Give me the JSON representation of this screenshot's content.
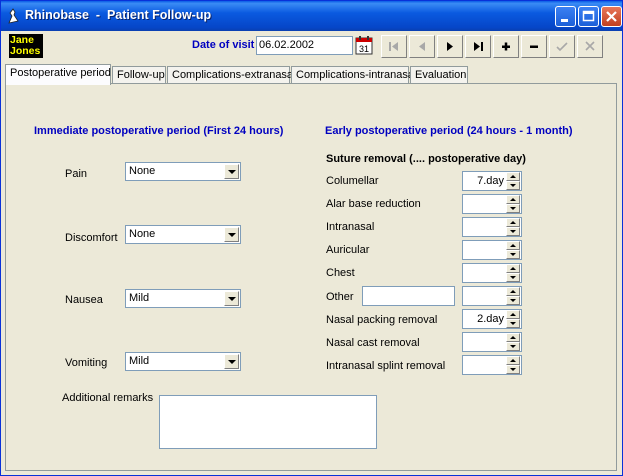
{
  "window": {
    "title": "Rhinobase  -  Patient Follow-up"
  },
  "patient": {
    "name_line1": "Jane",
    "name_line2": "Jones"
  },
  "visit": {
    "label": "Date of visit",
    "date": "06.02.2002"
  },
  "nav": [
    "first-icon",
    "prev-icon",
    "next-icon",
    "last-icon",
    "add-icon",
    "delete-icon",
    "save-icon",
    "cancel-icon"
  ],
  "tabs": [
    {
      "label": "Postoperative period",
      "active": true
    },
    {
      "label": "Follow-up"
    },
    {
      "label": "Complications-extranasal"
    },
    {
      "label": "Complications-intranasal"
    },
    {
      "label": "Evaluation"
    }
  ],
  "immediate": {
    "title": "Immediate postoperative period (First 24 hours)",
    "fields": [
      {
        "label": "Pain",
        "value": "None"
      },
      {
        "label": "Discomfort",
        "value": "None"
      },
      {
        "label": "Nausea",
        "value": "Mild"
      },
      {
        "label": "Vomiting",
        "value": "Mild"
      }
    ],
    "remarks_label": "Additional remarks",
    "remarks_value": ""
  },
  "early": {
    "title": "Early postoperative period (24 hours - 1 month)",
    "suture_title": "Suture removal (.... postoperative day)",
    "fields": [
      {
        "label": "Columellar",
        "value": "7.day"
      },
      {
        "label": "Alar base reduction",
        "value": ""
      },
      {
        "label": "Intranasal",
        "value": ""
      },
      {
        "label": "Auricular",
        "value": ""
      },
      {
        "label": "Chest",
        "value": ""
      },
      {
        "label": "Other",
        "value": ""
      },
      {
        "label": "Nasal packing removal",
        "value": "2.day"
      },
      {
        "label": "Nasal cast removal",
        "value": ""
      },
      {
        "label": "Intranasal splint removal",
        "value": ""
      }
    ],
    "other_text": ""
  }
}
